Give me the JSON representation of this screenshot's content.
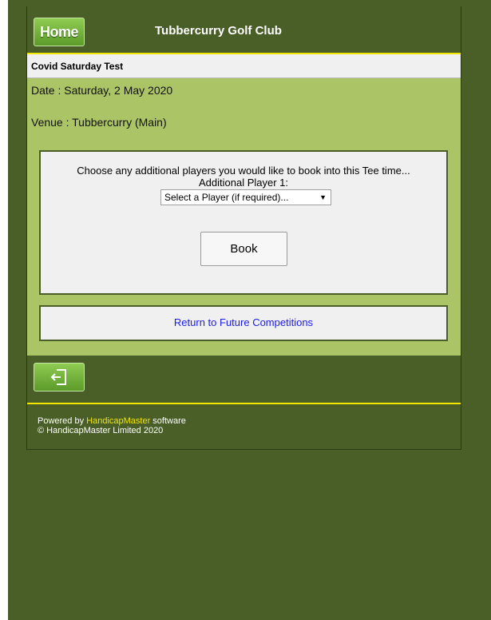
{
  "header": {
    "home_label": "Home",
    "club_name": "Tubbercurry Golf Club"
  },
  "competition": {
    "name": "Covid Saturday Test",
    "date_text": "Date : Saturday, 2 May 2020",
    "venue_text": "Venue : Tubbercurry (Main)"
  },
  "booking": {
    "instructions": "Choose any additional players you would like to book into this Tee time...",
    "player_label": "Additional Player 1:",
    "player_select_value": "Select a Player (if required)...",
    "book_label": "Book"
  },
  "return_link": "Return to Future Competitions",
  "footer": {
    "exit_icon": "exit-door-icon",
    "powered_prefix": "Powered by ",
    "powered_brand": "HandicapMaster",
    "powered_suffix": " software",
    "copyright": "© HandicapMaster Limited 2020"
  },
  "colors": {
    "page_bg": "#4a5e27",
    "content_bg": "#abc466",
    "accent_line": "#f2e600",
    "button_green": "#72b03c",
    "link_blue": "#1a1aee"
  }
}
